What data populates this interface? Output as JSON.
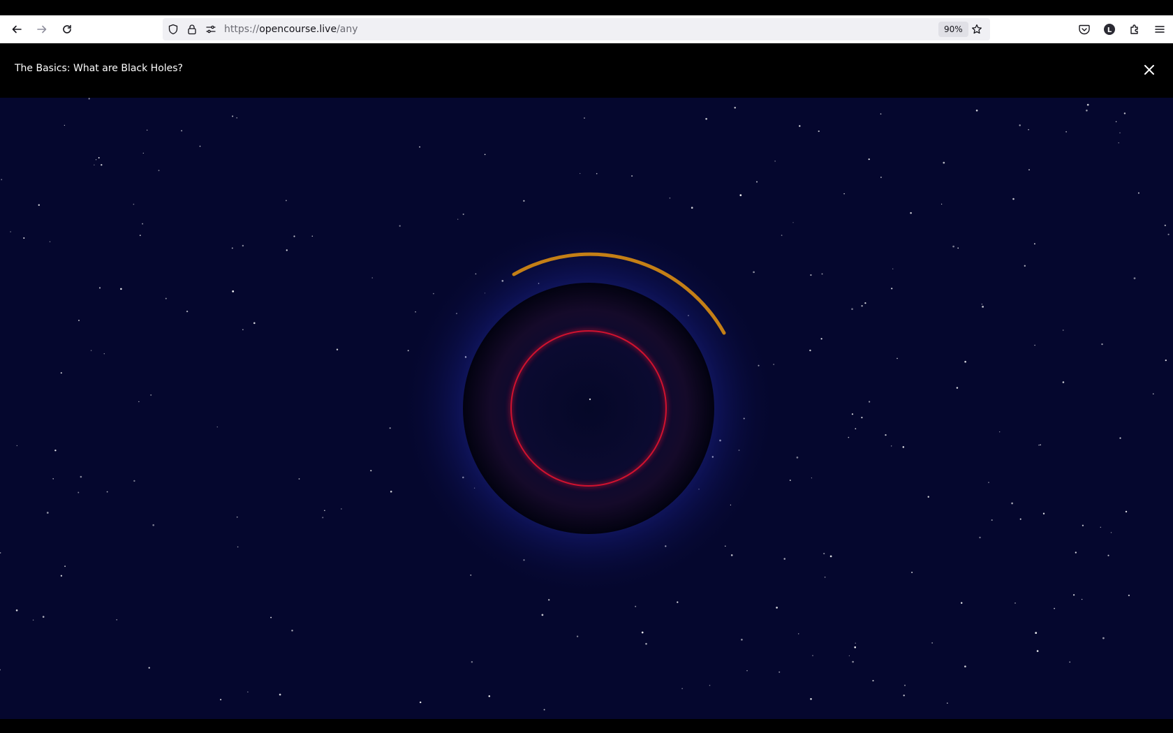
{
  "browser": {
    "url_scheme": "https://",
    "url_host": "opencourse.live",
    "url_path": "/any",
    "zoom": "90%"
  },
  "page": {
    "title": "The Basics: What are Black Holes?"
  },
  "colors": {
    "space_background": "#05072e",
    "event_horizon": "#030316",
    "photon_ring": "#c8102e",
    "accretion_arc": "#c47f16",
    "glow": "#4b56d6"
  },
  "icons": {
    "back": "arrow-left",
    "forward": "arrow-right",
    "reload": "reload",
    "tracking": "shield",
    "lock": "lock",
    "permissions": "sliders",
    "bookmark": "star",
    "pocket": "pocket",
    "account": "account-L",
    "extensions": "puzzle",
    "menu": "hamburger",
    "close": "x"
  },
  "account_initial": "L"
}
